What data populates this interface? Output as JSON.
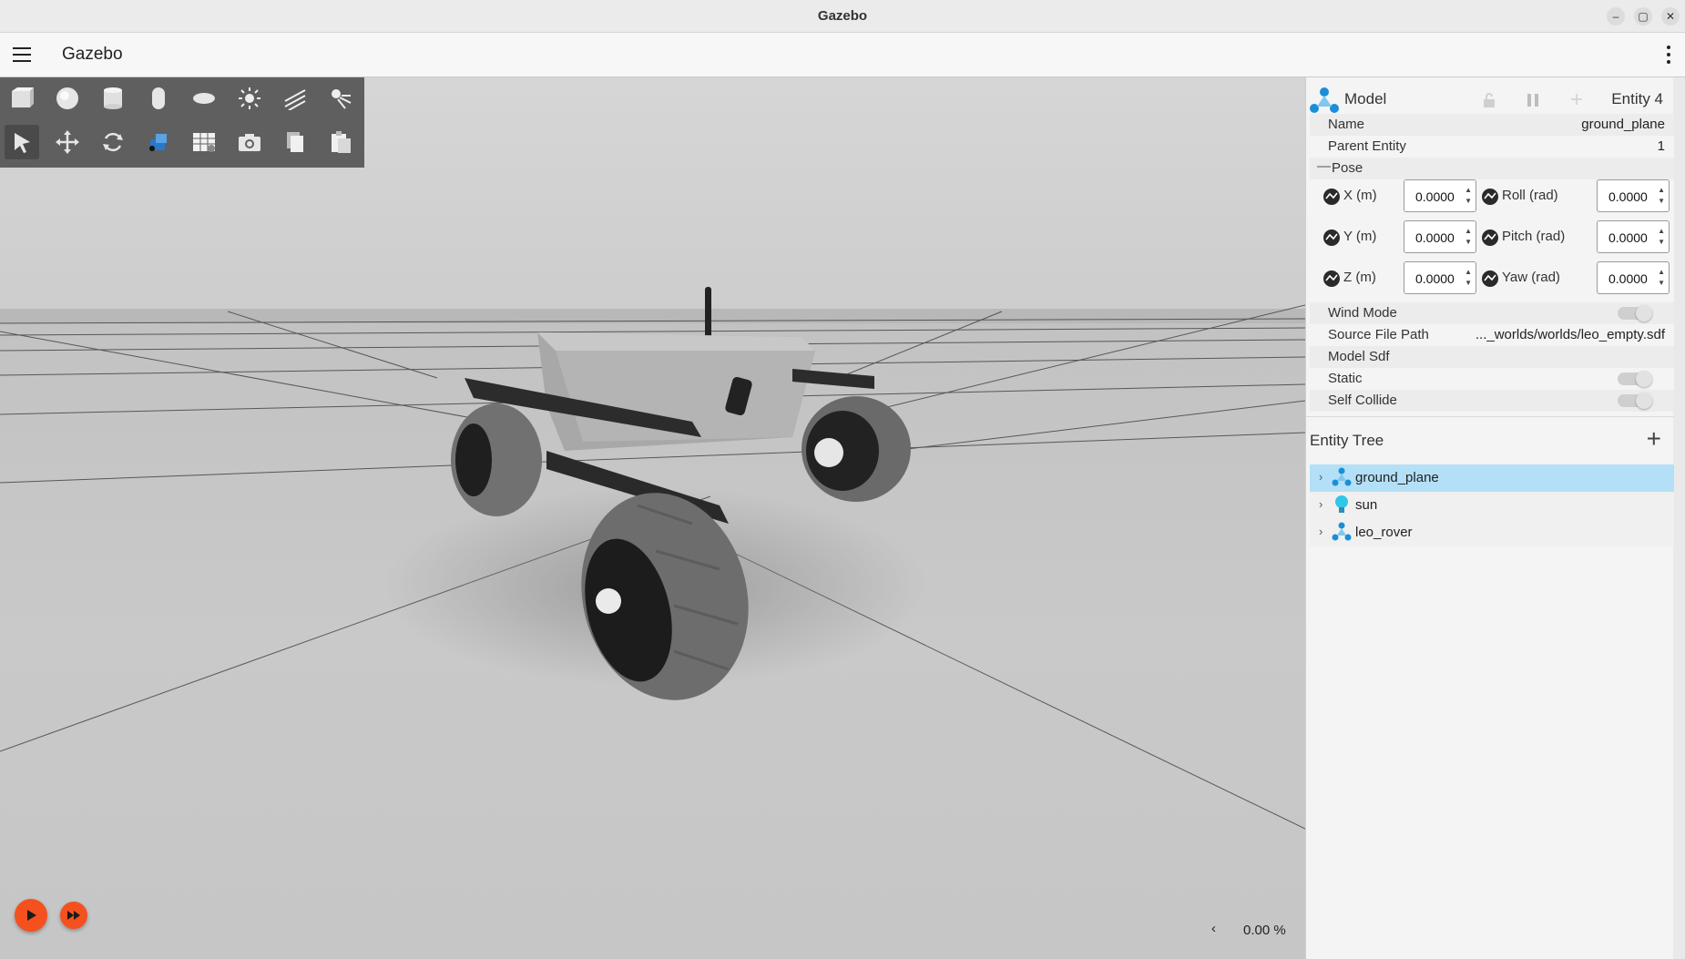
{
  "window": {
    "title": "Gazebo"
  },
  "header": {
    "app_title": "Gazebo"
  },
  "toolbar": {
    "shapes": [
      "box-icon",
      "sphere-icon",
      "cylinder-icon",
      "capsule-icon",
      "ellipsoid-icon",
      "point-light-icon",
      "directional-light-icon",
      "spot-light-icon"
    ],
    "tools": [
      "select-icon",
      "translate-icon",
      "rotate-icon",
      "view-angle-icon",
      "grid-snap-icon",
      "screenshot-icon",
      "copy-icon",
      "paste-icon"
    ]
  },
  "playback": {
    "real_time_factor": "0.00 %",
    "prev_label": "‹"
  },
  "component_inspector": {
    "type_label": "Model",
    "entity_label": "Entity 4",
    "name_label": "Name",
    "name_value": "ground_plane",
    "parent_label": "Parent Entity",
    "parent_value": "1",
    "pose_label": "Pose",
    "pose_collapse": "—",
    "pose": {
      "x_label": "X (m)",
      "x_value": "0.0000",
      "y_label": "Y (m)",
      "y_value": "0.0000",
      "z_label": "Z (m)",
      "z_value": "0.0000",
      "roll_label": "Roll (rad)",
      "roll_value": "0.0000",
      "pitch_label": "Pitch (rad)",
      "pitch_value": "0.0000",
      "yaw_label": "Yaw (rad)",
      "yaw_value": "0.0000"
    },
    "wind_mode_label": "Wind Mode",
    "source_file_label": "Source File Path",
    "source_file_value": "..._worlds/worlds/leo_empty.sdf",
    "model_sdf_label": "Model Sdf",
    "static_label": "Static",
    "self_collide_label": "Self Collide"
  },
  "entity_tree": {
    "title": "Entity Tree",
    "add_label": "+",
    "items": [
      {
        "label": "ground_plane",
        "icon": "model-icon",
        "selected": true
      },
      {
        "label": "sun",
        "icon": "light-bulb-icon",
        "selected": false
      },
      {
        "label": "leo_rover",
        "icon": "model-icon",
        "selected": false
      }
    ]
  },
  "colors": {
    "accent": "#f4511e",
    "selection": "#b3e0f7",
    "toolbar": "#5f5f5f"
  }
}
